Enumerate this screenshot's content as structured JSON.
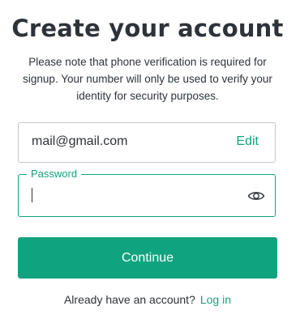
{
  "title": "Create your account",
  "subtitle": "Please note that phone verification is required for signup. Your number will only be used to verify your identity for security purposes.",
  "email": {
    "value": "mail@gmail.com",
    "edit_label": "Edit"
  },
  "password": {
    "label": "Password",
    "value": "",
    "toggle_icon": "eye-icon"
  },
  "continue_label": "Continue",
  "footer": {
    "prompt": "Already have an account?",
    "login_label": "Log in"
  },
  "colors": {
    "accent": "#10a37f",
    "text": "#2d333a",
    "border": "#c2c8d0"
  }
}
